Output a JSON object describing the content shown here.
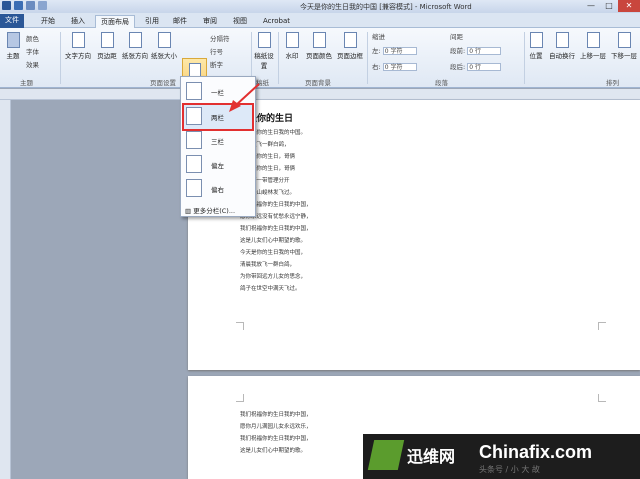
{
  "window": {
    "title": "今天是你的生日我的中国 [兼容模式] - Microsoft Word",
    "minimize": "—",
    "maximize": "□",
    "close": "✕"
  },
  "tabs": [
    "文件",
    "开始",
    "插入",
    "页面布局",
    "引用",
    "邮件",
    "审阅",
    "视图",
    "Acrobat"
  ],
  "ribbon": {
    "theme": {
      "colors": "颜色",
      "fonts": "字体",
      "effects": "效果",
      "label": "主题",
      "main": "主题"
    },
    "page_setup": {
      "text_direction": "文字方向",
      "margins": "页边距",
      "orientation": "纸张方向",
      "size": "纸张大小",
      "columns": "分栏",
      "breaks": "分隔符",
      "line_numbers": "行号",
      "hyphenation": "断字",
      "label": "页面设置"
    },
    "draft": "稿纸设置",
    "draft_group": "稿纸",
    "background": {
      "watermark": "水印",
      "page_color": "页面颜色",
      "page_borders": "页面边框",
      "label": "页面背景"
    },
    "indent": {
      "title": "缩进",
      "left_label": "左:",
      "left_value": "0 字符",
      "right_label": "右:",
      "right_value": "0 字符"
    },
    "spacing": {
      "title": "间距",
      "before_label": "段前:",
      "before_value": "0 行",
      "after_label": "段后:",
      "after_value": "0 行"
    },
    "paragraph_label": "段落",
    "arrange": {
      "position": "位置",
      "wrap": "自动换行",
      "forward": "上移一层",
      "backward": "下移一层",
      "label": "排列"
    }
  },
  "columns_menu": {
    "items": [
      "一栏",
      "两栏",
      "三栏",
      "偏左",
      "偏右"
    ],
    "more": "更多分栏(C)...",
    "highlighted": "两栏"
  },
  "document": {
    "title": "今天是你的生日",
    "lines": [
      "请祝福你的生日我的中国。",
      "请我放飞一群白鸽，",
      "请祝福你的生日，哥俩",
      "请祝福你的生日，哥俩",
      "从一带一带管理分开",
      "带着美山峻林发飞过。",
      "我们祝福你的生日我的中国，",
      "愿你永远没有忧愁永远宁静，",
      "我们祝福你的生日我的中国，",
      "这是儿女们心中期望的歌。",
      "今天是你的生日我的中国，",
      "清晨我放飞一群白鸽，",
      "为你带回远方儿女的思念，",
      "鸽子在世空中满天飞过。"
    ],
    "page2_lines": [
      "我们祝福你的生日我的中国，",
      "愿你月儿满园儿女永远欢乐，",
      "我们祝福你的生日我的中国，",
      "这是儿女们心中期望的歌。"
    ]
  },
  "watermark": {
    "cn": "迅维网",
    "en": "Chinafix.com",
    "faint": "头条号 / 小 大 故"
  },
  "colors": {
    "accent": "#2b5797",
    "highlight": "#e23030"
  }
}
